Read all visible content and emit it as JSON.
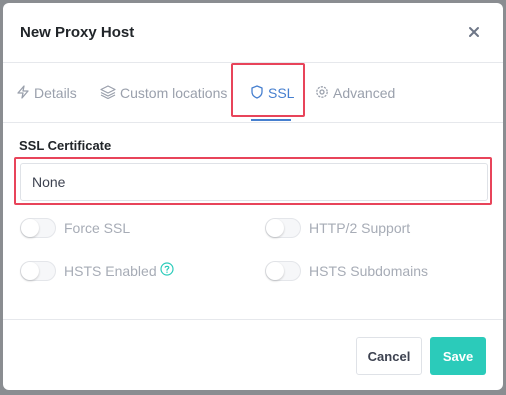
{
  "modal": {
    "title": "New Proxy Host",
    "close_icon": "close-icon"
  },
  "tabs": [
    {
      "label": "Details",
      "icon": "bolt-icon"
    },
    {
      "label": "Custom locations",
      "icon": "layers-icon"
    },
    {
      "label": "SSL",
      "icon": "shield-icon",
      "active": true
    },
    {
      "label": "Advanced",
      "icon": "gear-icon"
    }
  ],
  "ssl": {
    "certificate_label": "SSL Certificate",
    "certificate_value": "None",
    "toggles": [
      {
        "label": "Force SSL",
        "enabled": false
      },
      {
        "label": "HTTP/2 Support",
        "enabled": false
      },
      {
        "label": "HSTS Enabled",
        "enabled": false,
        "help_icon": "help-circle-icon"
      },
      {
        "label": "HSTS Subdomains",
        "enabled": false
      }
    ]
  },
  "footer": {
    "cancel_label": "Cancel",
    "save_label": "Save"
  },
  "colors": {
    "accent": "#467fcf",
    "save": "#2bcbba",
    "highlight": "#e8445a"
  }
}
